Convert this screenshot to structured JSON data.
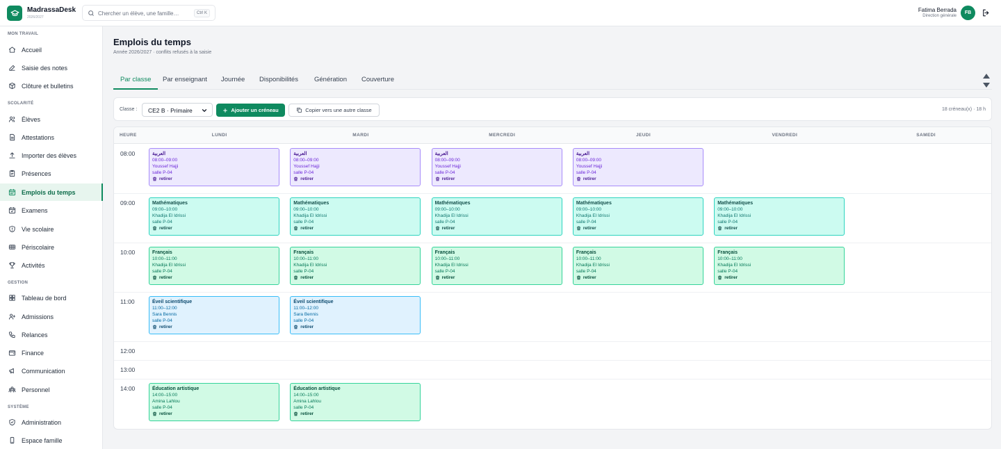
{
  "app": {
    "name": "MadrassaDesk",
    "year": "2026/2027"
  },
  "search": {
    "placeholder": "Chercher un élève, une famille…",
    "shortcut": "Ctrl K"
  },
  "user": {
    "name": "Fatima Berrada",
    "role": "Direction générale",
    "initials": "FB"
  },
  "sidebar": {
    "sections": [
      {
        "title": "MON TRAVAIL",
        "items": [
          {
            "label": "Accueil",
            "icon": "home-icon"
          },
          {
            "label": "Saisie des notes",
            "icon": "pencil-icon"
          },
          {
            "label": "Clôture et bulletins",
            "icon": "package-icon"
          }
        ]
      },
      {
        "title": "SCOLARITÉ",
        "items": [
          {
            "label": "Élèves",
            "icon": "users-icon"
          },
          {
            "label": "Attestations",
            "icon": "document-icon"
          },
          {
            "label": "Importer des élèves",
            "icon": "upload-icon"
          },
          {
            "label": "Présences",
            "icon": "clipboard-icon"
          },
          {
            "label": "Emplois du temps",
            "icon": "calendar-icon",
            "active": true
          },
          {
            "label": "Examens",
            "icon": "calendar-check-icon"
          },
          {
            "label": "Vie scolaire",
            "icon": "shield-icon"
          },
          {
            "label": "Périscolaire",
            "icon": "ticket-icon"
          },
          {
            "label": "Activités",
            "icon": "trophy-icon"
          }
        ]
      },
      {
        "title": "GESTION",
        "items": [
          {
            "label": "Tableau de bord",
            "icon": "dashboard-icon"
          },
          {
            "label": "Admissions",
            "icon": "user-plus-icon"
          },
          {
            "label": "Relances",
            "icon": "phone-icon"
          },
          {
            "label": "Finance",
            "icon": "wallet-icon"
          },
          {
            "label": "Communication",
            "icon": "megaphone-icon"
          },
          {
            "label": "Personnel",
            "icon": "team-icon"
          }
        ]
      },
      {
        "title": "SYSTÈME",
        "items": [
          {
            "label": "Administration",
            "icon": "shield-check-icon"
          },
          {
            "label": "Espace famille",
            "icon": "phone-device-icon"
          }
        ]
      }
    ]
  },
  "page": {
    "title": "Emplois du temps",
    "subtitle": "Année 2026/2027 · conflits refusés à la saisie"
  },
  "tabs": [
    {
      "label": "Par classe",
      "active": true
    },
    {
      "label": "Par enseignant"
    },
    {
      "label": "Journée"
    },
    {
      "label": "Disponibilités"
    },
    {
      "label": "Génération"
    },
    {
      "label": "Couverture"
    }
  ],
  "toolbar": {
    "class_label": "Classe :",
    "class_value": "CE2 B · Primaire",
    "add_label": "Ajouter un créneau",
    "copy_label": "Copier vers une autre classe",
    "summary": "18 créneau(x) · 18 h"
  },
  "grid": {
    "hour_header": "HEURE",
    "days": [
      "LUNDI",
      "MARDI",
      "MERCREDI",
      "JEUDI",
      "VENDREDI",
      "SAMEDI"
    ],
    "hours": [
      "08:00",
      "09:00",
      "10:00",
      "11:00",
      "12:00",
      "13:00",
      "14:00"
    ],
    "remove_label": "retirer",
    "slots": [
      {
        "day": 0,
        "hour": 0,
        "color": "purple",
        "subject": "العربية",
        "time": "08:00–09:00",
        "teacher": "Youssef Hajji",
        "room": "salle P-04"
      },
      {
        "day": 1,
        "hour": 0,
        "color": "purple",
        "subject": "العربية",
        "time": "08:00–09:00",
        "teacher": "Youssef Hajji",
        "room": "salle P-04"
      },
      {
        "day": 2,
        "hour": 0,
        "color": "purple",
        "subject": "العربية",
        "time": "08:00–09:00",
        "teacher": "Youssef Hajji",
        "room": "salle P-04"
      },
      {
        "day": 3,
        "hour": 0,
        "color": "purple",
        "subject": "العربية",
        "time": "08:00–09:00",
        "teacher": "Youssef Hajji",
        "room": "salle P-04"
      },
      {
        "day": 0,
        "hour": 1,
        "color": "teal",
        "subject": "Mathématiques",
        "time": "09:00–10:00",
        "teacher": "Khadija El Idrissi",
        "room": "salle P-04"
      },
      {
        "day": 1,
        "hour": 1,
        "color": "teal",
        "subject": "Mathématiques",
        "time": "09:00–10:00",
        "teacher": "Khadija El Idrissi",
        "room": "salle P-04"
      },
      {
        "day": 2,
        "hour": 1,
        "color": "teal",
        "subject": "Mathématiques",
        "time": "09:00–10:00",
        "teacher": "Khadija El Idrissi",
        "room": "salle P-04"
      },
      {
        "day": 3,
        "hour": 1,
        "color": "teal",
        "subject": "Mathématiques",
        "time": "09:00–10:00",
        "teacher": "Khadija El Idrissi",
        "room": "salle P-04"
      },
      {
        "day": 4,
        "hour": 1,
        "color": "teal",
        "subject": "Mathématiques",
        "time": "09:00–10:00",
        "teacher": "Khadija El Idrissi",
        "room": "salle P-04"
      },
      {
        "day": 0,
        "hour": 2,
        "color": "green",
        "subject": "Français",
        "time": "10:00–11:00",
        "teacher": "Khadija El Idrissi",
        "room": "salle P-04"
      },
      {
        "day": 1,
        "hour": 2,
        "color": "green",
        "subject": "Français",
        "time": "10:00–11:00",
        "teacher": "Khadija El Idrissi",
        "room": "salle P-04"
      },
      {
        "day": 2,
        "hour": 2,
        "color": "green",
        "subject": "Français",
        "time": "10:00–11:00",
        "teacher": "Khadija El Idrissi",
        "room": "salle P-04"
      },
      {
        "day": 3,
        "hour": 2,
        "color": "green",
        "subject": "Français",
        "time": "10:00–11:00",
        "teacher": "Khadija El Idrissi",
        "room": "salle P-04"
      },
      {
        "day": 4,
        "hour": 2,
        "color": "green",
        "subject": "Français",
        "time": "10:00–11:00",
        "teacher": "Khadija El Idrissi",
        "room": "salle P-04"
      },
      {
        "day": 0,
        "hour": 3,
        "color": "blue",
        "subject": "Éveil scientifique",
        "time": "11:00–12:00",
        "teacher": "Sara Bennis",
        "room": "salle P-04"
      },
      {
        "day": 1,
        "hour": 3,
        "color": "blue",
        "subject": "Éveil scientifique",
        "time": "11:00–12:00",
        "teacher": "Sara Bennis",
        "room": "salle P-04"
      },
      {
        "day": 0,
        "hour": 6,
        "color": "mint",
        "subject": "Éducation artistique",
        "time": "14:00–15:00",
        "teacher": "Amina Lahlou",
        "room": "salle P-04"
      },
      {
        "day": 1,
        "hour": 6,
        "color": "mint",
        "subject": "Éducation artistique",
        "time": "14:00–15:00",
        "teacher": "Amina Lahlou",
        "room": "salle P-04"
      }
    ]
  },
  "colors": {
    "accent": "#0f8a5f",
    "active_bg": "#e7f5ee"
  }
}
